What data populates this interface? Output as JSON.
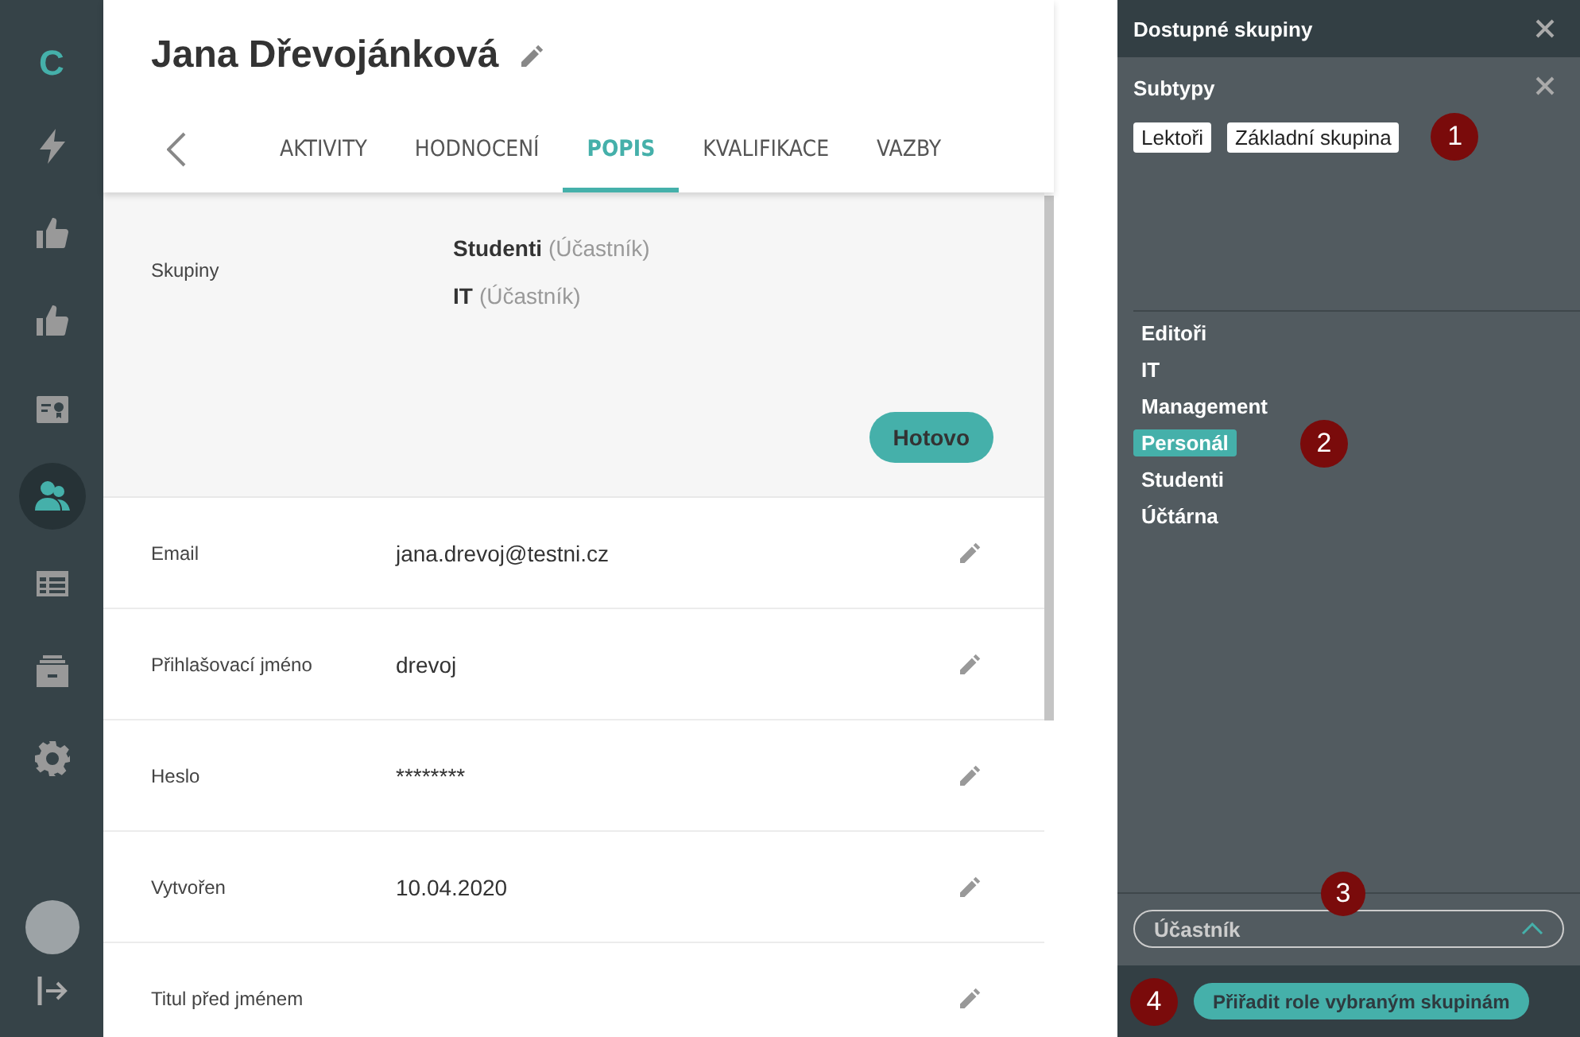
{
  "sidebar": {
    "logo": "C",
    "items": [
      {
        "kind": "bolt",
        "selected": false
      },
      {
        "kind": "thumb",
        "selected": false
      },
      {
        "kind": "thumb",
        "selected": false
      },
      {
        "kind": "card",
        "selected": false
      },
      {
        "kind": "users",
        "selected": true
      },
      {
        "kind": "table",
        "selected": false
      },
      {
        "kind": "archive",
        "selected": false
      },
      {
        "kind": "gear",
        "selected": false
      }
    ]
  },
  "profile": {
    "name": "Jana Dřevojánková",
    "tabs": [
      {
        "label": "AKTIVITY",
        "selected": false
      },
      {
        "label": "HODNOCENÍ",
        "selected": false
      },
      {
        "label": "POPIS",
        "selected": true
      },
      {
        "label": "KVALIFIKACE",
        "selected": false
      },
      {
        "label": "VAZBY",
        "selected": false
      }
    ],
    "groups": {
      "label": "Skupiny",
      "items": [
        {
          "name": "Studenti",
          "role": "(Účastník)"
        },
        {
          "name": "IT",
          "role": "(Účastník)"
        }
      ],
      "done_button": "Hotovo"
    },
    "fields": [
      {
        "label": "Email",
        "value": "jana.drevoj@testni.cz"
      },
      {
        "label": "Přihlašovací jméno",
        "value": "drevoj"
      },
      {
        "label": "Heslo",
        "value": "********"
      },
      {
        "label": "Vytvořen",
        "value": "10.04.2020"
      },
      {
        "label": "Titul před jménem"
      }
    ]
  },
  "panel": {
    "title": "Dostupné skupiny",
    "subtypes_title": "Subtypy",
    "subtypes": [
      "Lektoři",
      "Základní skupina"
    ],
    "groups": [
      {
        "name": "Editoři",
        "selected": false
      },
      {
        "name": "IT",
        "selected": false
      },
      {
        "name": "Management",
        "selected": false
      },
      {
        "name": "Personál",
        "selected": true
      },
      {
        "name": "Studenti",
        "selected": false
      },
      {
        "name": "Účtárna",
        "selected": false
      }
    ],
    "role_select": "Účastník",
    "assign_button": "Přiřadit role vybraným skupinám"
  },
  "markers": [
    "1",
    "2",
    "3",
    "4"
  ]
}
